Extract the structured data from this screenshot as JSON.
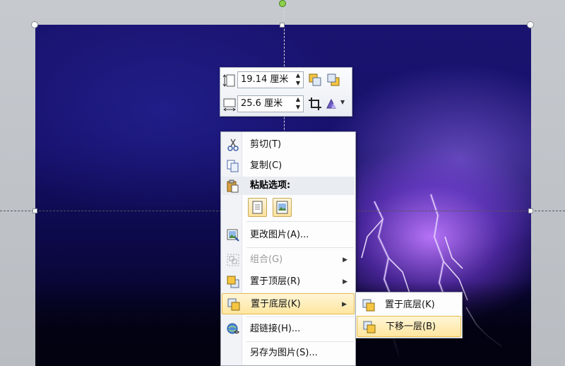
{
  "mini_toolbar": {
    "height_value": "19.14 厘米",
    "width_value": "25.6 厘米",
    "icons": [
      "shape-height-icon",
      "bring-forward-icon",
      "send-backward-icon",
      "shape-width-icon",
      "crop-icon",
      "picture-styles-icon"
    ]
  },
  "context_menu": {
    "items": [
      {
        "label": "剪切(T)",
        "icon": "scissors-icon"
      },
      {
        "label": "复制(C)",
        "icon": "copy-icon"
      },
      {
        "label": "粘贴选项:",
        "icon": "paste-icon"
      },
      {
        "label": "更改图片(A)...",
        "icon": "change-picture-icon"
      },
      {
        "label": "组合(G)",
        "icon": "group-icon",
        "disabled": true
      },
      {
        "label": "置于顶层(R)",
        "icon": "bring-to-front-icon"
      },
      {
        "label": "置于底层(K)",
        "icon": "send-to-back-icon",
        "highlighted": true
      },
      {
        "label": "超链接(H)...",
        "icon": "hyperlink-icon"
      },
      {
        "label": "另存为图片(S)...",
        "icon": "save-as-picture-icon"
      }
    ]
  },
  "submenu": {
    "items": [
      {
        "label": "置于底层(K)",
        "icon": "send-to-back-icon"
      },
      {
        "label": "下移一层(B)",
        "icon": "send-backward-icon",
        "highlighted": true
      }
    ]
  },
  "colors": {
    "highlight": "#ffe6a0",
    "highlight_border": "#e6bb4b",
    "sky_dark": "#0d0a4c",
    "lightning_glow": "#be78ff"
  }
}
